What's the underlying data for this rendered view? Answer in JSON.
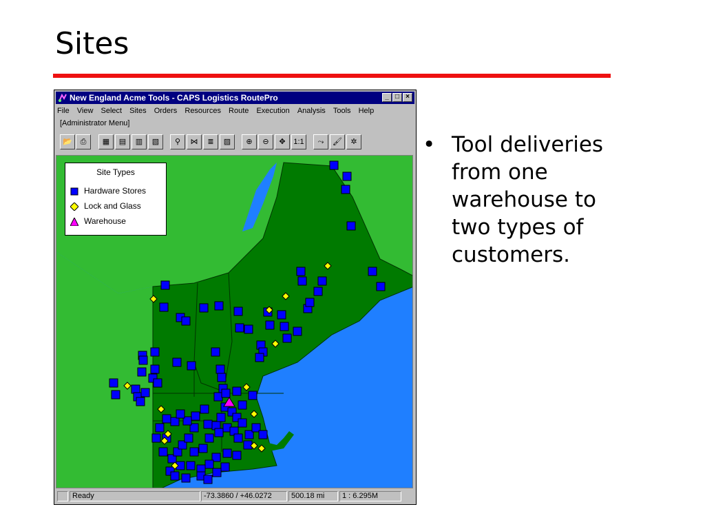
{
  "slide": {
    "title": "Sites",
    "bullet": "Tool deliveries from one warehouse to two types of customers.",
    "rule_color": "#ee1111"
  },
  "window": {
    "title": "New England Acme Tools - CAPS Logistics RoutePro",
    "minimize": "_",
    "maximize": "□",
    "close": "×",
    "menu": [
      {
        "label": "File"
      },
      {
        "label": "View"
      },
      {
        "label": "Select"
      },
      {
        "label": "Sites"
      },
      {
        "label": "Orders"
      },
      {
        "label": "Resources"
      },
      {
        "label": "Route"
      },
      {
        "label": "Execution"
      },
      {
        "label": "Analysis"
      },
      {
        "label": "Tools"
      },
      {
        "label": "Help"
      }
    ],
    "admin_menu": "[Administrator Menu]",
    "toolbar_icons": [
      "open-folder-icon",
      "print-icon",
      "table-icon",
      "table-icon",
      "table-icon",
      "table-icon",
      "find-icon",
      "network-icon",
      "list-icon",
      "chart-icon",
      "zoom-in-icon",
      "zoom-out-icon",
      "pan-icon",
      "one-to-one-icon",
      "route-icon",
      "brush-icon",
      "wand-icon"
    ],
    "toolbar_text": {
      "one_to_one": "1:1"
    }
  },
  "map": {
    "land_color": "#007a00",
    "neighbor_land_color": "#33bb33",
    "water_color": "#1f7fff",
    "legend": {
      "title": "Site Types",
      "items": [
        {
          "label": "Hardware Stores",
          "symbol": "blue-square",
          "color": "#0000ff"
        },
        {
          "label": "Lock and Glass",
          "symbol": "yellow-diamond",
          "color": "#ffff00"
        },
        {
          "label": "Warehouse",
          "symbol": "magenta-triangle",
          "color": "#ff00ff"
        }
      ]
    }
  },
  "statusbar": {
    "ready": "Ready",
    "coords": "-73.3860 / +46.0272",
    "distance": "500.18 mi",
    "scale": "1 : 6.295M"
  }
}
